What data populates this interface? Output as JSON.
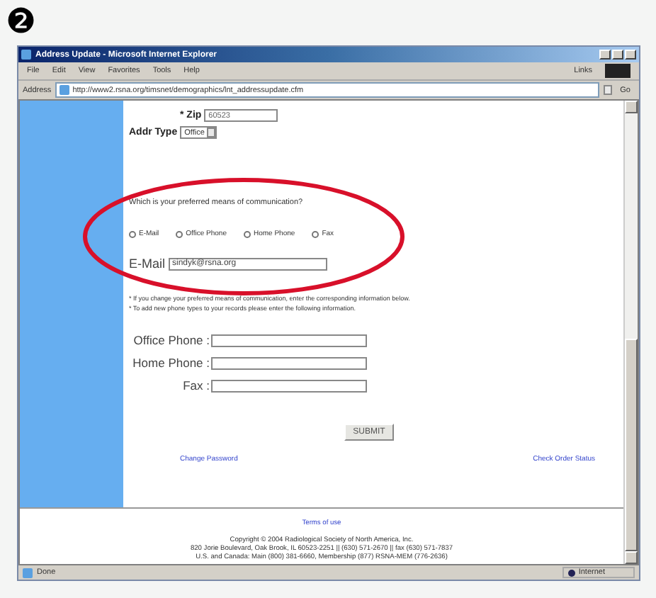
{
  "step_marker": "❷",
  "window": {
    "title": "Address Update - Microsoft Internet Explorer"
  },
  "menu": [
    "File",
    "Edit",
    "View",
    "Favorites",
    "Tools",
    "Help"
  ],
  "links_label": "Links",
  "address_bar": {
    "label": "Address",
    "url": "http://www2.rsna.org/timsnet/demographics/lnt_addressupdate.cfm",
    "go": "Go"
  },
  "form": {
    "zip": {
      "label": "* Zip",
      "value": "60523"
    },
    "addr_type": {
      "label": "Addr Type",
      "value": "Office"
    },
    "question": "Which is your preferred means of communication?",
    "options": [
      {
        "label": "E-Mail",
        "selected": false
      },
      {
        "label": "Office Phone",
        "selected": false
      },
      {
        "label": "Home Phone",
        "selected": false
      },
      {
        "label": "Fax",
        "selected": false
      }
    ],
    "email": {
      "label": "E-Mail",
      "value": "sindyk@rsna.org"
    },
    "notes": [
      "* If you change your preferred means of communication, enter the corresponding information below.",
      "* To add new phone types to your records please enter the following information."
    ],
    "phones": [
      {
        "label": "Office Phone :"
      },
      {
        "label": "Home Phone :"
      },
      {
        "label": "Fax :"
      }
    ],
    "submit": "SUBMIT",
    "links": [
      "Change Password",
      "Check Order Status"
    ]
  },
  "footer": {
    "terms": "Terms of use",
    "lines": [
      "Copyright © 2004 Radiological Society of North America, Inc.",
      "820 Jorie Boulevard, Oak Brook, IL 60523-2251 || (630) 571-2670 || fax (630) 571-7837",
      "U.S. and Canada: Main (800) 381-6660, Membership (877) RSNA-MEM (776-2636)"
    ]
  },
  "status_bar": {
    "text": "Done",
    "zone": "Internet"
  }
}
